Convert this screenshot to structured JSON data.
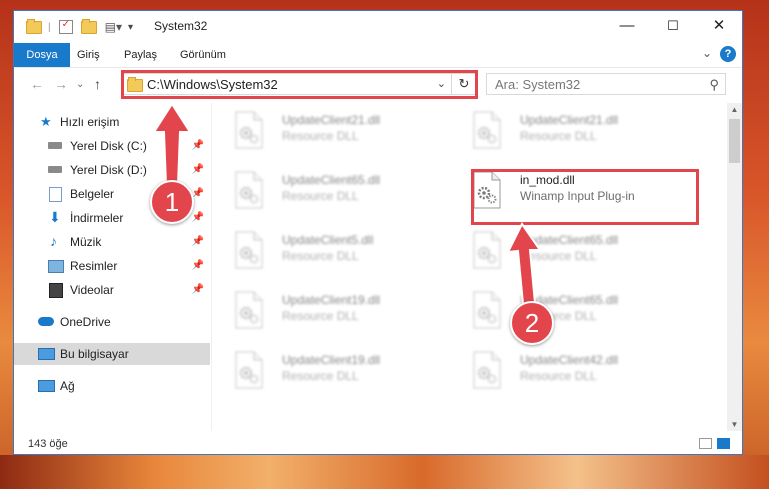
{
  "window": {
    "title": "System32",
    "controls": {
      "minimize": "—",
      "maximize": "☐",
      "close": "✕"
    }
  },
  "ribbon": {
    "tabs": [
      {
        "label": "Dosya",
        "active": true
      },
      {
        "label": "Giriş"
      },
      {
        "label": "Paylaş"
      },
      {
        "label": "Görünüm"
      }
    ],
    "help": "?"
  },
  "address": {
    "path": "C:\\Windows\\System32",
    "search_placeholder": "Ara: System32"
  },
  "sidebar": {
    "items": [
      {
        "label": "Hızlı erişim",
        "icon": "star-icon",
        "pinned": false
      },
      {
        "label": "Yerel Disk (C:)",
        "icon": "drive-icon",
        "pinned": true
      },
      {
        "label": "Yerel Disk (D:)",
        "icon": "drive-icon",
        "pinned": true
      },
      {
        "label": "Belgeler",
        "icon": "documents-icon",
        "pinned": true
      },
      {
        "label": "İndirmeler",
        "icon": "download-icon",
        "pinned": true
      },
      {
        "label": "Müzik",
        "icon": "music-icon",
        "pinned": true
      },
      {
        "label": "Resimler",
        "icon": "pictures-icon",
        "pinned": true
      },
      {
        "label": "Videolar",
        "icon": "videos-icon",
        "pinned": true
      },
      {
        "label": "OneDrive",
        "icon": "cloud-icon",
        "pinned": false
      },
      {
        "label": "Bu bilgisayar",
        "icon": "computer-icon",
        "pinned": false,
        "selected": true
      },
      {
        "label": "Ağ",
        "icon": "network-icon",
        "pinned": false
      }
    ]
  },
  "files": {
    "left_column": [
      {
        "name": "UpdateClient21.dll",
        "type": "Resource DLL"
      },
      {
        "name": "UpdateClient65.dll",
        "type": "Resource DLL"
      },
      {
        "name": "UpdateClient5.dll",
        "type": "Resource DLL"
      },
      {
        "name": "UpdateClient19.dll",
        "type": "Resource DLL"
      },
      {
        "name": "UpdateClient19.dll",
        "type": "Resource DLL"
      }
    ],
    "right_column": [
      {
        "name": "UpdateClient21.dll",
        "type": "Resource DLL"
      },
      {
        "name": "in_mod.dll",
        "type": "Winamp Input Plug-in",
        "highlighted": true
      },
      {
        "name": "UpdateClient65.dll",
        "type": "Resource DLL"
      },
      {
        "name": "UpdateClient65.dll",
        "type": "Resource DLL"
      },
      {
        "name": "UpdateClient42.dll",
        "type": "Resource DLL"
      }
    ]
  },
  "status": {
    "count": "143 öğe"
  },
  "callouts": {
    "one": "1",
    "two": "2"
  },
  "colors": {
    "accent": "#1979ca",
    "highlight": "#e2454b"
  }
}
